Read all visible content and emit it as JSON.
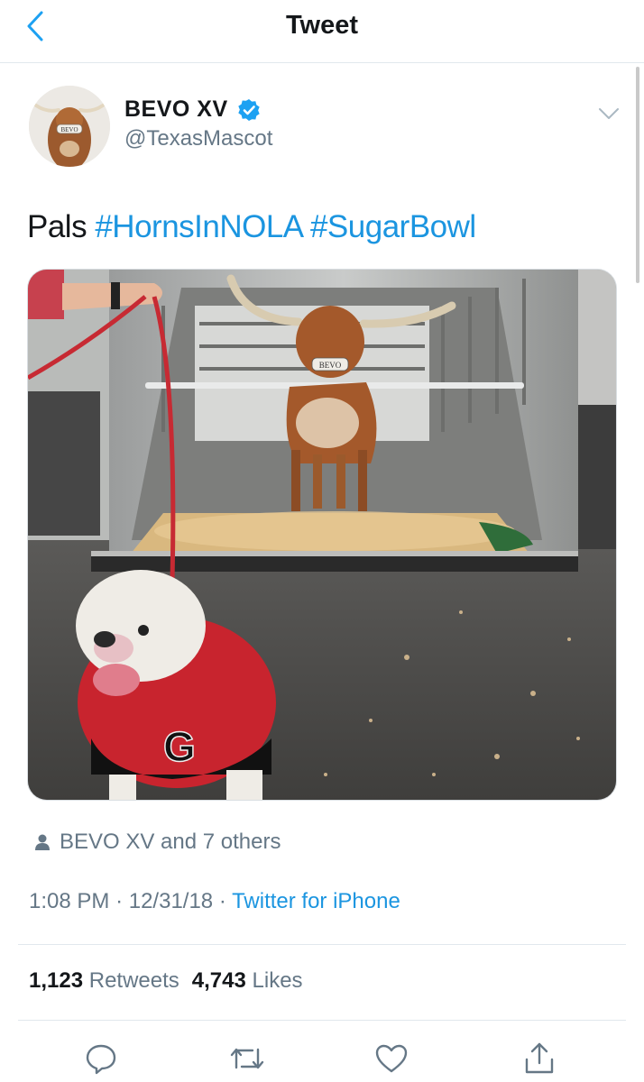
{
  "header": {
    "title": "Tweet"
  },
  "tweet": {
    "author": {
      "display_name": "BEVO XV",
      "handle": "@TexasMascot",
      "verified": true,
      "avatar_label": "BEVO"
    },
    "text": {
      "prefix": "Pals",
      "hashtags": [
        "#HornsInNOLA",
        "#SugarBowl"
      ]
    },
    "media": {
      "collar_label": "BEVO"
    },
    "social_context": {
      "text": "BEVO XV and 7 others"
    },
    "meta": {
      "time": "1:08 PM",
      "date": "12/31/18",
      "separator": "·",
      "source": "Twitter for iPhone"
    },
    "stats": {
      "retweets": {
        "count": "1,123",
        "label": "Retweets"
      },
      "likes": {
        "count": "4,743",
        "label": "Likes"
      }
    }
  },
  "colors": {
    "link": "#1b95e0",
    "secondary_text": "#657786",
    "divider": "#e1e8ed",
    "verified": "#1da1f2"
  },
  "icons": [
    "back-chevron-icon",
    "verified-badge-icon",
    "chevron-down-icon",
    "person-icon",
    "reply-icon",
    "retweet-icon",
    "like-icon",
    "share-icon"
  ]
}
